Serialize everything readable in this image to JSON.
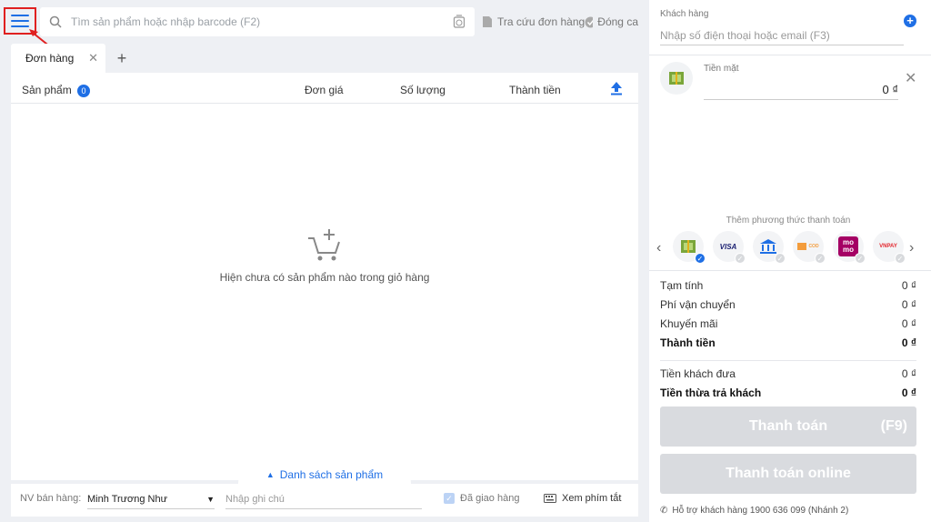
{
  "search": {
    "placeholder": "Tìm sản phẩm hoặc nhập barcode (F2)"
  },
  "top_actions": {
    "order_lookup": "Tra cứu đơn hàng",
    "close_shift": "Đóng ca"
  },
  "tabs": [
    {
      "label": "Đơn hàng"
    }
  ],
  "cart": {
    "columns": {
      "product": "Sản phẩm",
      "product_count": "0",
      "unit_price": "Đơn giá",
      "quantity": "Số lượng",
      "total": "Thành tiền"
    },
    "empty_message": "Hiện chưa có sản phẩm nào trong giỏ hàng"
  },
  "product_list_tab": "Danh sách sản phẩm",
  "bottom": {
    "staff_label": "NV bán hàng:",
    "staff_value": "Minh Trương Như",
    "note_placeholder": "Nhập ghi chú",
    "delivered_label": "Đã giao hàng",
    "shortcuts_label": "Xem phím tắt"
  },
  "customer": {
    "label": "Khách hàng",
    "placeholder": "Nhập số điện thoại hoặc email (F3)"
  },
  "cash": {
    "label": "Tiền mặt",
    "amount": "0 ₫"
  },
  "payment_methods": {
    "title": "Thêm phương thức thanh toán",
    "items": [
      {
        "name": "cash",
        "selected": true
      },
      {
        "name": "visa",
        "text": "VISA",
        "selected": false
      },
      {
        "name": "bank-transfer",
        "selected": false
      },
      {
        "name": "cod",
        "text": "COD",
        "selected": false
      },
      {
        "name": "momo",
        "text": "mo mo",
        "selected": false
      },
      {
        "name": "vnpay",
        "text": "VNPAY",
        "selected": false
      }
    ]
  },
  "summary": {
    "subtotal_label": "Tạm tính",
    "subtotal": "0 ₫",
    "shipping_label": "Phí vận chuyển",
    "shipping": "0 ₫",
    "discount_label": "Khuyến mãi",
    "discount": "0 ₫",
    "total_label": "Thành tiền",
    "total": "0 ₫",
    "paid_label": "Tiền khách đưa",
    "paid": "0 ₫",
    "change_label": "Tiền thừa trả khách",
    "change": "0 ₫"
  },
  "buttons": {
    "pay": "Thanh toán",
    "pay_shortcut": "(F9)",
    "pay_online": "Thanh toán online"
  },
  "support": "Hỗ trợ khách hàng 1900 636 099 (Nhánh 2)",
  "colors": {
    "accent": "#1f6fe5",
    "highlight_box": "#e02020",
    "disabled_button": "#d9dbdf"
  }
}
